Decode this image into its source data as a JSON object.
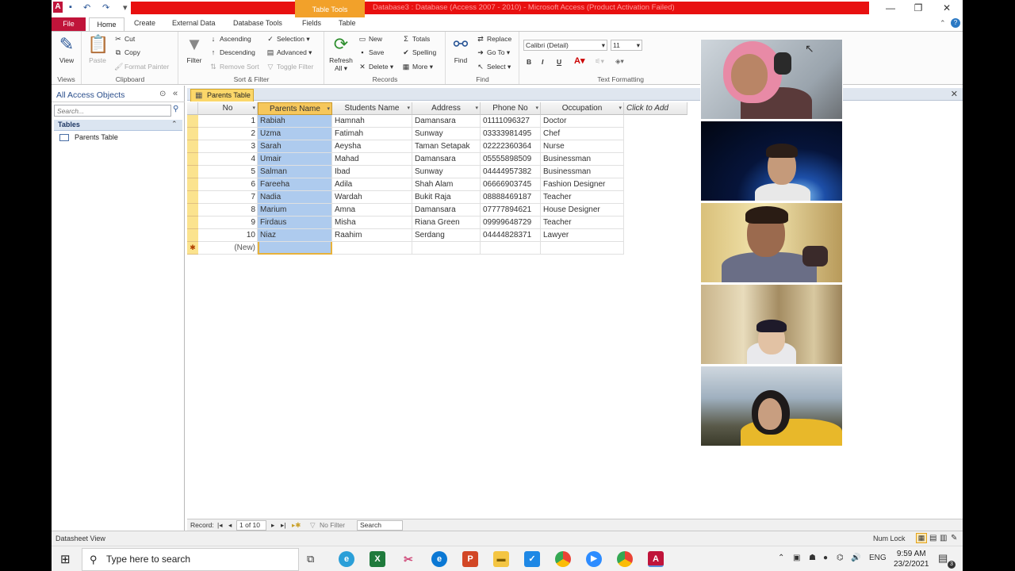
{
  "titlebar": {
    "title": "Database3 : Database (Access 2007 - 2010) - Microsoft Access (Product Activation Failed)",
    "context_tab": "Table Tools",
    "app_icon": "A"
  },
  "ribbon_tabs": {
    "file": "File",
    "home": "Home",
    "create": "Create",
    "external_data": "External Data",
    "database_tools": "Database Tools",
    "fields": "Fields",
    "table": "Table"
  },
  "ribbon": {
    "views": {
      "view": "View",
      "label": "Views"
    },
    "clipboard": {
      "paste": "Paste",
      "cut": "Cut",
      "copy": "Copy",
      "format_painter": "Format Painter",
      "label": "Clipboard"
    },
    "sort_filter": {
      "filter": "Filter",
      "ascending": "Ascending",
      "descending": "Descending",
      "remove_sort": "Remove Sort",
      "selection": "Selection ▾",
      "advanced": "Advanced ▾",
      "toggle_filter": "Toggle Filter",
      "label": "Sort & Filter"
    },
    "records": {
      "refresh": "Refresh",
      "refresh_sub": "All ▾",
      "new": "New",
      "save": "Save",
      "delete": "Delete ▾",
      "totals": "Totals",
      "spelling": "Spelling",
      "more": "More ▾",
      "label": "Records"
    },
    "find": {
      "find": "Find",
      "replace": "Replace",
      "goto": "Go To ▾",
      "select": "Select ▾",
      "label": "Find"
    },
    "text_formatting": {
      "font": "Calibri (Detail)",
      "size": "11",
      "bold": "B",
      "italic": "I",
      "underline": "U",
      "label": "Text Formatting"
    }
  },
  "nav_pane": {
    "title": "All Access Objects",
    "search_placeholder": "Search...",
    "group": "Tables",
    "items": [
      {
        "label": "Parents Table"
      }
    ]
  },
  "document": {
    "tab_label": "Parents Table",
    "columns": [
      "No",
      "Parents Name",
      "Students Name",
      "Address",
      "Phone No",
      "Occupation",
      "Click to Add"
    ],
    "rows": [
      {
        "no": "1",
        "parent": "Rabiah",
        "student": "Hamnah",
        "address": "Damansara",
        "phone": "01111096327",
        "occupation": "Doctor"
      },
      {
        "no": "2",
        "parent": "Uzma",
        "student": "Fatimah",
        "address": "Sunway",
        "phone": "03333981495",
        "occupation": "Chef"
      },
      {
        "no": "3",
        "parent": "Sarah",
        "student": "Aeysha",
        "address": "Taman Setapak",
        "phone": "02222360364",
        "occupation": "Nurse"
      },
      {
        "no": "4",
        "parent": "Umair",
        "student": "Mahad",
        "address": "Damansara",
        "phone": "05555898509",
        "occupation": "Businessman"
      },
      {
        "no": "5",
        "parent": "Salman",
        "student": "Ibad",
        "address": "Sunway",
        "phone": "04444957382",
        "occupation": "Businessman"
      },
      {
        "no": "6",
        "parent": "Fareeha",
        "student": "Adila",
        "address": "Shah Alam",
        "phone": "06666903745",
        "occupation": "Fashion Designer"
      },
      {
        "no": "7",
        "parent": "Nadia",
        "student": "Wardah",
        "address": "Bukit Raja",
        "phone": "08888469187",
        "occupation": "Teacher"
      },
      {
        "no": "8",
        "parent": "Marium",
        "student": "Amna",
        "address": "Damansara",
        "phone": "07777894621",
        "occupation": "House Designer"
      },
      {
        "no": "9",
        "parent": "Firdaus",
        "student": "Misha",
        "address": "Riana Green",
        "phone": "09999648729",
        "occupation": "Teacher"
      },
      {
        "no": "10",
        "parent": "Niaz",
        "student": "Raahim",
        "address": "Serdang",
        "phone": "04444828371",
        "occupation": "Lawyer"
      }
    ],
    "new_row_label": "(New)",
    "new_row_marker": "✱"
  },
  "record_nav": {
    "label": "Record:",
    "position": "1 of 10",
    "no_filter": "No Filter",
    "search": "Search"
  },
  "status": {
    "left": "Datasheet View",
    "num_lock": "Num Lock"
  },
  "taskbar": {
    "search_placeholder": "Type here to search",
    "language": "ENG",
    "time": "9:59 AM",
    "date": "23/2/2021",
    "notifications": "3"
  },
  "colors": {
    "titlebar_red": "#e81010",
    "file_tab": "#c0143a",
    "selected_column": "#aecbee",
    "context_tab": "#f2a12a",
    "doc_tab": "#fbd76a"
  }
}
